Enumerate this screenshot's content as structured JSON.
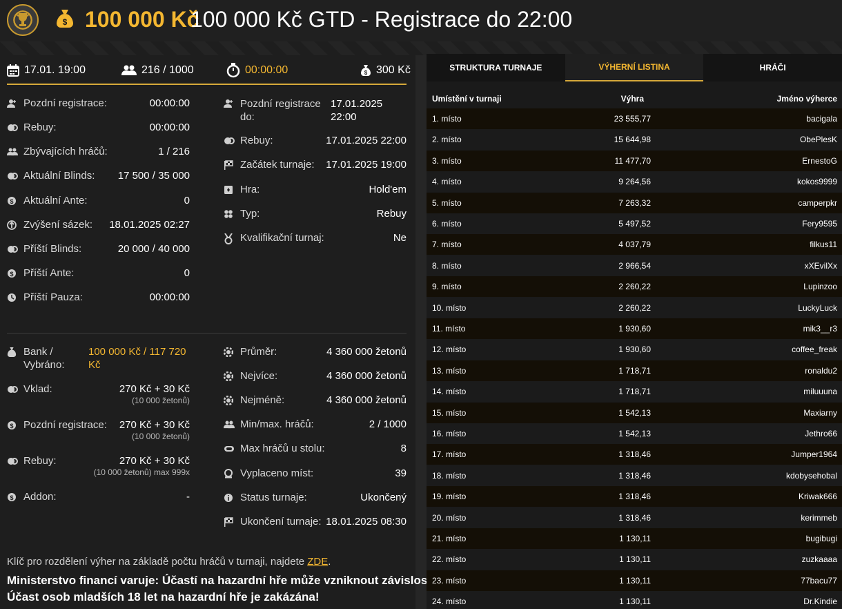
{
  "header": {
    "amount": "100 000 Kč",
    "title": "100 000 Kč GTD - Registrace do 22:00"
  },
  "summary": {
    "date": "17.01. 19:00",
    "players": "216 / 1000",
    "timer": "00:00:00",
    "buyin": "300 Kč"
  },
  "left_col": [
    {
      "label": "Pozdní registrace:",
      "value": "00:00:00",
      "icon": "user-plus-icon"
    },
    {
      "label": "Rebuy:",
      "value": "00:00:00",
      "icon": "coins-icon"
    },
    {
      "label": "Zbývajících hráčů:",
      "value": "1 / 216",
      "icon": "users-icon"
    },
    {
      "label": "Aktuální Blinds:",
      "value": "17 500 / 35 000",
      "icon": "coins-icon"
    },
    {
      "label": "Aktuální Ante:",
      "value": "0",
      "icon": "dollar-circle-icon"
    },
    {
      "label": "Zvýšení sázek:",
      "value": "18.01.2025 02:27",
      "icon": "arrow-up-circle-icon"
    },
    {
      "label": "Příští Blinds:",
      "value": "20 000 / 40 000",
      "icon": "coins-icon"
    },
    {
      "label": "Příští Ante:",
      "value": "0",
      "icon": "dollar-circle-icon"
    },
    {
      "label": "Příští Pauza:",
      "value": "00:00:00",
      "icon": "clock-icon"
    }
  ],
  "right_col": [
    {
      "label": "Pozdní registrace do:",
      "value": "17.01.2025 22:00",
      "icon": "user-plus-icon"
    },
    {
      "label": "Rebuy:",
      "value": "17.01.2025 22:00",
      "icon": "coins-icon"
    },
    {
      "label": "Začátek turnaje:",
      "value": "17.01.2025 19:00",
      "icon": "flag-icon"
    },
    {
      "label": "Hra:",
      "value": "Hold'em",
      "icon": "cards-icon"
    },
    {
      "label": "Typ:",
      "value": "Rebuy",
      "icon": "clover-icon"
    },
    {
      "label": "Kvalifikační turnaj:",
      "value": "Ne",
      "icon": "medal-icon"
    }
  ],
  "bottom_left": {
    "bank_label": "Bank / Vybráno:",
    "bank_value": "100 000 Kč / 117 720 Kč",
    "vklad_label": "Vklad:",
    "vklad_value": "270 Kč + 30 Kč",
    "vklad_sub": "(10 000 žetonů)",
    "late_label": "Pozdní registrace:",
    "late_value": "270 Kč + 30 Kč",
    "late_sub": "(10 000 žetonů)",
    "rebuy_label": "Rebuy:",
    "rebuy_value": "270 Kč + 30 Kč",
    "rebuy_sub": "(10 000 žetonů) max 999x",
    "addon_label": "Addon:",
    "addon_value": "-"
  },
  "bottom_right": [
    {
      "label": "Průměr:",
      "value": "4 360 000 žetonů",
      "icon": "chip-icon"
    },
    {
      "label": "Nejvíce:",
      "value": "4 360 000 žetonů",
      "icon": "chip-icon"
    },
    {
      "label": "Nejméně:",
      "value": "4 360 000 žetonů",
      "icon": "chip-icon"
    },
    {
      "label": "Min/max. hráčů:",
      "value": "2 / 1000",
      "icon": "users-icon"
    },
    {
      "label": "Max hráčů u stolu:",
      "value": "8",
      "icon": "table-icon"
    },
    {
      "label": "Vyplaceno míst:",
      "value": "39",
      "icon": "payout-icon"
    },
    {
      "label": "Status turnaje:",
      "value": "Ukončený",
      "icon": "info-icon"
    },
    {
      "label": "Ukončení turnaje:",
      "value": "18.01.2025 08:30",
      "icon": "flag-icon"
    }
  ],
  "note": {
    "text": "Klíč pro rozdělení výher na základě počtu hráčů v turnaji, najdete ",
    "link": "ZDE",
    "end": "."
  },
  "warnings": [
    "Ministerstvo financí varuje: Účastí na hazardní hře může vzniknout závislost!",
    "Účast osob mladších 18 let na hazardní hře je zakázána!"
  ],
  "tabs": [
    "STRUKTURA TURNAJE",
    "VÝHERNÍ LISTINA",
    "HRÁČI"
  ],
  "table": {
    "headers": [
      "Umístění v turnaji",
      "Výhra",
      "Jméno výherce"
    ],
    "rows": [
      [
        "1. místo",
        "23 555,77",
        "bacigala"
      ],
      [
        "2. místo",
        "15 644,98",
        "ObePlesK"
      ],
      [
        "3. místo",
        "11 477,70",
        "ErnestoG"
      ],
      [
        "4. místo",
        "9 264,56",
        "kokos9999"
      ],
      [
        "5. místo",
        "7 263,32",
        "camperpkr"
      ],
      [
        "6. místo",
        "5 497,52",
        "Fery9595"
      ],
      [
        "7. místo",
        "4 037,79",
        "filkus11"
      ],
      [
        "8. místo",
        "2 966,54",
        "xXEvilXx"
      ],
      [
        "9. místo",
        "2 260,22",
        "Lupinzoo"
      ],
      [
        "10. místo",
        "2 260,22",
        "LuckyLuck"
      ],
      [
        "11. místo",
        "1 930,60",
        "mik3__r3"
      ],
      [
        "12. místo",
        "1 930,60",
        "coffee_freak"
      ],
      [
        "13. místo",
        "1 718,71",
        "ronaldu2"
      ],
      [
        "14. místo",
        "1 718,71",
        "miluuuna"
      ],
      [
        "15. místo",
        "1 542,13",
        "Maxiarny"
      ],
      [
        "16. místo",
        "1 542,13",
        "Jethro66"
      ],
      [
        "17. místo",
        "1 318,46",
        "Jumper1964"
      ],
      [
        "18. místo",
        "1 318,46",
        "kdobysehobal"
      ],
      [
        "19. místo",
        "1 318,46",
        "Kriwak666"
      ],
      [
        "20. místo",
        "1 318,46",
        "kerimmeb"
      ],
      [
        "21. místo",
        "1 130,11",
        "bugibugi"
      ],
      [
        "22. místo",
        "1 130,11",
        "zuzkaaaa"
      ],
      [
        "23. místo",
        "1 130,11",
        "77bacu77"
      ],
      [
        "24. místo",
        "1 130,11",
        "Dr.Kindie"
      ]
    ]
  },
  "colors": {
    "accent": "#f4b731",
    "background": "#1b1b1b"
  }
}
